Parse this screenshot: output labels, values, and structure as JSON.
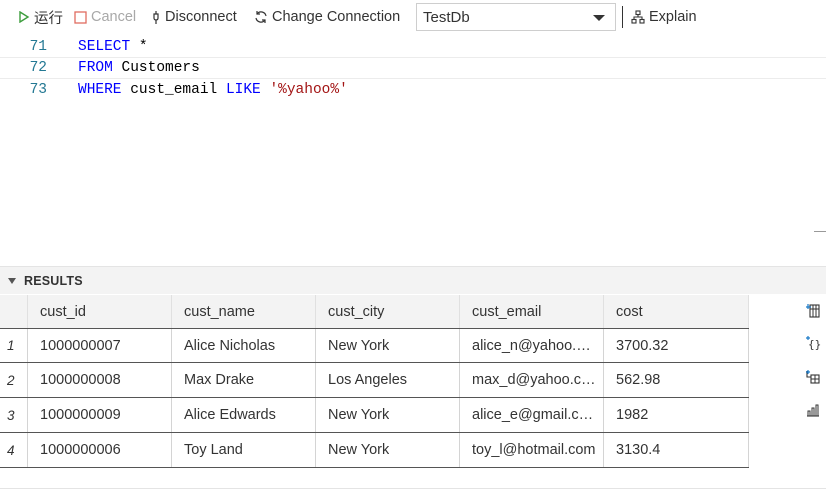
{
  "toolbar": {
    "run_label": "运行",
    "cancel_label": "Cancel",
    "disconnect_label": "Disconnect",
    "change_connection_label": "Change Connection",
    "connection_value": "TestDb",
    "explain_label": "Explain"
  },
  "editor": {
    "lines": [
      {
        "number": "71",
        "tokens": [
          {
            "t": "SELECT",
            "k": "kw"
          },
          {
            "t": " *",
            "k": ""
          }
        ]
      },
      {
        "number": "72",
        "tokens": [
          {
            "t": "FROM",
            "k": "kw"
          },
          {
            "t": " Customers",
            "k": ""
          }
        ]
      },
      {
        "number": "73",
        "tokens": [
          {
            "t": "WHERE",
            "k": "kw"
          },
          {
            "t": " cust_email ",
            "k": ""
          },
          {
            "t": "LIKE",
            "k": "kw"
          },
          {
            "t": " ",
            "k": ""
          },
          {
            "t": "'%yahoo%'",
            "k": "str"
          }
        ]
      }
    ]
  },
  "results": {
    "title": "RESULTS",
    "columns": [
      "cust_id",
      "cust_name",
      "cust_city",
      "cust_email",
      "cost"
    ],
    "rows": [
      {
        "index": "1",
        "cells": [
          "1000000007",
          "Alice Nicholas",
          "New York",
          "alice_n@yahoo.com",
          "3700.32"
        ]
      },
      {
        "index": "2",
        "cells": [
          "1000000008",
          "Max Drake",
          "Los Angeles",
          "max_d@yahoo.com",
          "562.98"
        ]
      },
      {
        "index": "3",
        "cells": [
          "1000000009",
          "Alice Edwards",
          "New York",
          "alice_e@gmail.com",
          "1982"
        ]
      },
      {
        "index": "4",
        "cells": [
          "1000000006",
          "Toy Land",
          "New York",
          "toy_l@hotmail.com",
          "3130.4"
        ]
      }
    ]
  },
  "side_actions": [
    {
      "name": "save-csv-icon"
    },
    {
      "name": "save-json-icon"
    },
    {
      "name": "save-excel-icon"
    },
    {
      "name": "chart-icon"
    }
  ],
  "colors": {
    "keyword": "#0000ff",
    "string": "#a31515",
    "line_number": "#237893",
    "run_green": "#3c9d3c",
    "cancel_red": "#e06c60"
  }
}
